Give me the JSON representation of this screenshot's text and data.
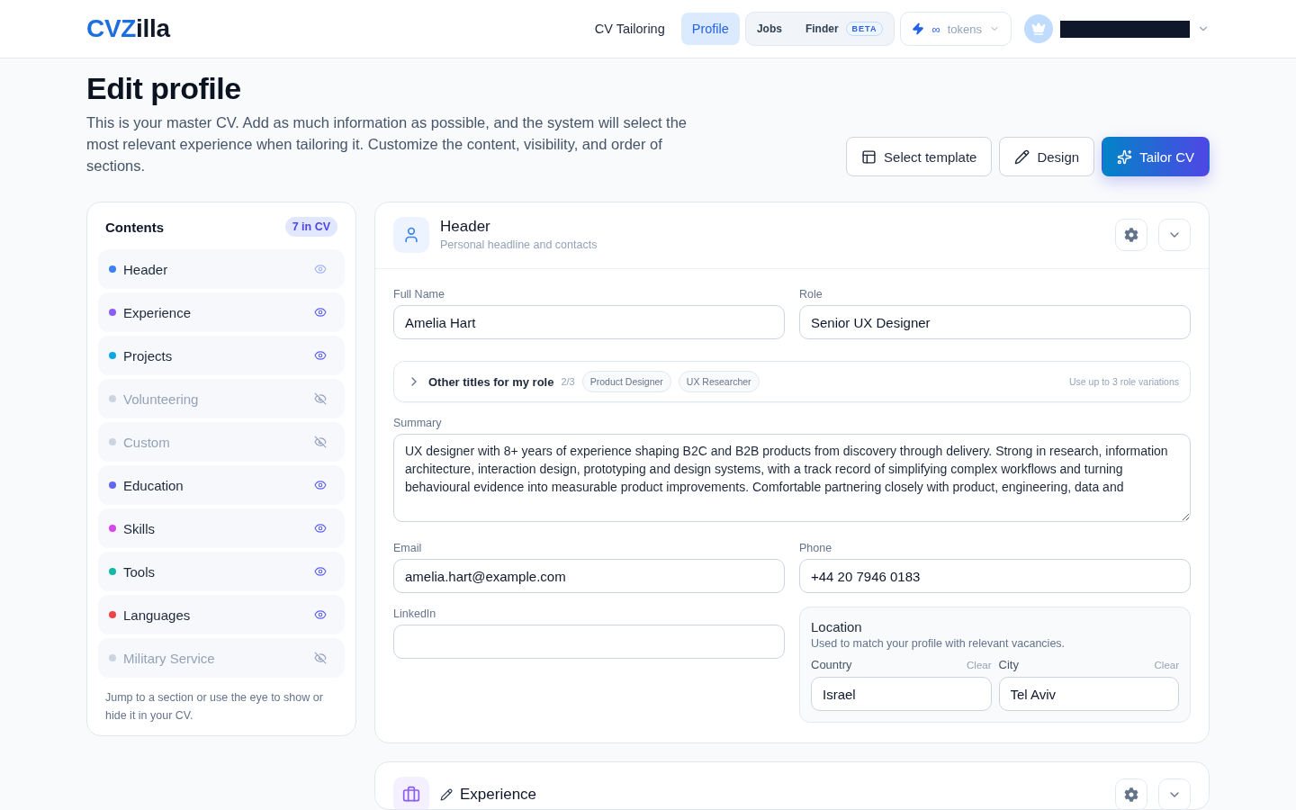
{
  "topbar": {
    "logo": {
      "accent": "CVZ",
      "rest": "illa"
    },
    "nav": [
      {
        "label": "CV Tailoring",
        "selected": false
      },
      {
        "label": "Profile",
        "selected": true
      }
    ],
    "jobs_finder": {
      "label_1": "Jobs",
      "label_2": "Finder",
      "badge": "BETA"
    },
    "tokens": {
      "amount": "∞",
      "label": "tokens"
    }
  },
  "page": {
    "title": "Edit profile",
    "description": "This is your master CV. Add as much information as possible, and the system will select the most relevant experience when tailoring it. Customize the content, visibility, and order of sections.",
    "actions": [
      {
        "kind": "template",
        "label": "Select template"
      },
      {
        "kind": "design",
        "label": "Design"
      },
      {
        "kind": "tailor",
        "label": "Tailor CV"
      }
    ]
  },
  "contents": {
    "title": "Contents",
    "badge": "7 in CV",
    "items": [
      {
        "label": "Header",
        "color": "#3b82f6",
        "visible": true,
        "locked": true
      },
      {
        "label": "Experience",
        "color": "#8b5cf6",
        "visible": true,
        "locked": false
      },
      {
        "label": "Projects",
        "color": "#0ea5e9",
        "visible": true,
        "locked": false
      },
      {
        "label": "Volunteering",
        "color": "#cbd5e1",
        "visible": false,
        "locked": false
      },
      {
        "label": "Custom",
        "color": "#cbd5e1",
        "visible": false,
        "locked": false
      },
      {
        "label": "Education",
        "color": "#6366f1",
        "visible": true,
        "locked": false
      },
      {
        "label": "Skills",
        "color": "#d946ef",
        "visible": true,
        "locked": false
      },
      {
        "label": "Tools",
        "color": "#14b8a6",
        "visible": true,
        "locked": false
      },
      {
        "label": "Languages",
        "color": "#ef4444",
        "visible": true,
        "locked": false
      },
      {
        "label": "Military Service",
        "color": "#cbd5e1",
        "visible": false,
        "locked": false
      }
    ],
    "hint": "Jump to a section or use the eye to show or hide it in your CV."
  },
  "sections": [
    {
      "kind": "header",
      "title": "Header",
      "subtitle": "Personal headline and contacts",
      "renamable": false,
      "form": {
        "full_name": {
          "label": "Full Name",
          "value": "Amelia Hart"
        },
        "role": {
          "label": "Role",
          "value": "Senior UX Designer"
        },
        "other_titles": {
          "label": "Other titles for my role",
          "count": "2/3",
          "expanded": false,
          "tags": [
            "Product Designer",
            "UX Researcher"
          ],
          "hint": "Use up to 3 role variations"
        },
        "summary": {
          "label": "Summary",
          "value": "UX designer with 8+ years of experience shaping B2C and B2B products from discovery through delivery. Strong in research, information\narchitecture, interaction design, prototyping and design systems, with a track record of simplifying complex workflows and turning behavioural evidence into measurable product improvements. Comfortable partnering closely with product, engineering, data and"
        },
        "email": {
          "label": "Email",
          "value": "amelia.hart@example.com"
        },
        "phone": {
          "label": "Phone",
          "value": "+44 20 7946 0183"
        },
        "linkedin": {
          "label": "LinkedIn"
        },
        "location": {
          "title": "Location",
          "subtitle": "Used to match your profile with relevant vacancies.",
          "country": {
            "label": "Country",
            "clear": "Clear",
            "value": "Israel"
          },
          "city": {
            "label": "City",
            "clear": "Clear",
            "value": "Tel Aviv"
          }
        }
      }
    },
    {
      "kind": "experience",
      "title": "Experience",
      "renamable": true
    }
  ]
}
